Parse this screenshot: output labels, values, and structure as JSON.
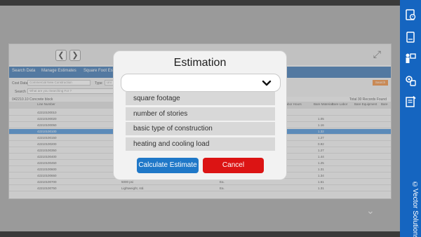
{
  "vendor_credit": "©Vector Solutions",
  "background_app": {
    "tabs": [
      "Search Data",
      "Manage Estimates",
      "Square Foot Esti"
    ],
    "filter": {
      "cost_data_label": "Cost Data",
      "cost_data_value": "Commercial New Construction",
      "type_label": "Type",
      "type_value": "Uni",
      "search_label": "Search",
      "search_placeholder": "What are you Searching For ?",
      "search_button": "Search"
    },
    "breadcrumb": "042210.10 Concrete block",
    "records_found": "Total 30 Records Found",
    "columns": [
      "Line Number",
      "Labor Hours",
      "Bare Material",
      "Bare Labor",
      "Bare Equipment",
      "Bare"
    ],
    "rows": [
      {
        "line": "42210100010",
        "desc": "",
        "unit": "",
        "material": "",
        "selected": false
      },
      {
        "line": "42210100020",
        "desc": "",
        "unit": "",
        "material": "1.05",
        "selected": false
      },
      {
        "line": "42210100050",
        "desc": "",
        "unit": "",
        "material": "1.16",
        "selected": false
      },
      {
        "line": "42210100100",
        "desc": "",
        "unit": "",
        "material": "1.32",
        "selected": true
      },
      {
        "line": "42210100150",
        "desc": "",
        "unit": "",
        "material": "1.27",
        "selected": false
      },
      {
        "line": "42210100200",
        "desc": "",
        "unit": "",
        "material": "0.92",
        "selected": false
      },
      {
        "line": "42210100350",
        "desc": "",
        "unit": "",
        "material": "1.27",
        "selected": false
      },
      {
        "line": "42210100400",
        "desc": "",
        "unit": "",
        "material": "1.44",
        "selected": false
      },
      {
        "line": "42210100450",
        "desc": "",
        "unit": "",
        "material": "1.25",
        "selected": false
      },
      {
        "line": "42210100600",
        "desc": "",
        "unit": "",
        "material": "1.31",
        "selected": false
      },
      {
        "line": "42210100650",
        "desc": "3000 psi",
        "unit": "Ea.",
        "material": "1.34",
        "selected": false
      },
      {
        "line": "42210100700",
        "desc": "5000 psi",
        "unit": "Ea.",
        "material": "1.61",
        "selected": false
      },
      {
        "line": "42210100750",
        "desc": "Lightweight, std.",
        "unit": "Ea.",
        "material": "1.31",
        "selected": false
      }
    ]
  },
  "modal": {
    "title": "Estimation",
    "dropdown_value": "",
    "options": [
      "square footage",
      "number of stories",
      "basic type of construction",
      "heating and cooling load"
    ],
    "calculate_button": "Calculate Estimate",
    "cancel_button": "Cancel"
  },
  "colors": {
    "accent_blue": "#1f78c8",
    "cancel_red": "#dc1414",
    "sidebar_blue": "#1565c0"
  }
}
